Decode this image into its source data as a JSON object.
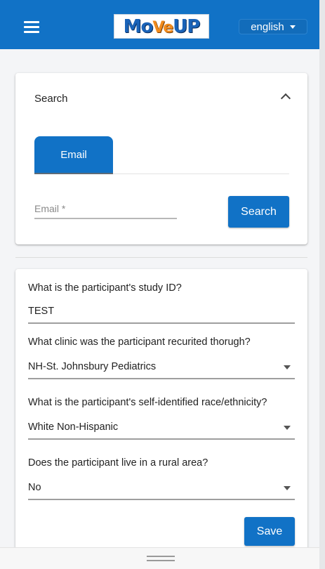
{
  "header": {
    "logo": "MoVeUP",
    "language": "english",
    "brand_color": "#1172c6",
    "menu_icon": "hamburger-icon"
  },
  "search_panel": {
    "title": "Search",
    "collapse_icon": "chevron-up-icon",
    "tabs": [
      {
        "label": "Email"
      }
    ],
    "email_placeholder": "Email *",
    "search_label": "Search"
  },
  "form": {
    "questions": [
      {
        "label": "What is the participant's study ID?",
        "value": "TEST",
        "type": "text"
      },
      {
        "label": "What clinic was the participant recurited thorugh?",
        "value": "NH-St. Johnsbury Pediatrics",
        "type": "select"
      },
      {
        "label": "What is the participant's self-identified race/ethnicity?",
        "value": "White Non-Hispanic",
        "type": "select"
      },
      {
        "label": "Does the participant live in a rural area?",
        "value": "No",
        "type": "select"
      }
    ],
    "save_label": "Save"
  }
}
